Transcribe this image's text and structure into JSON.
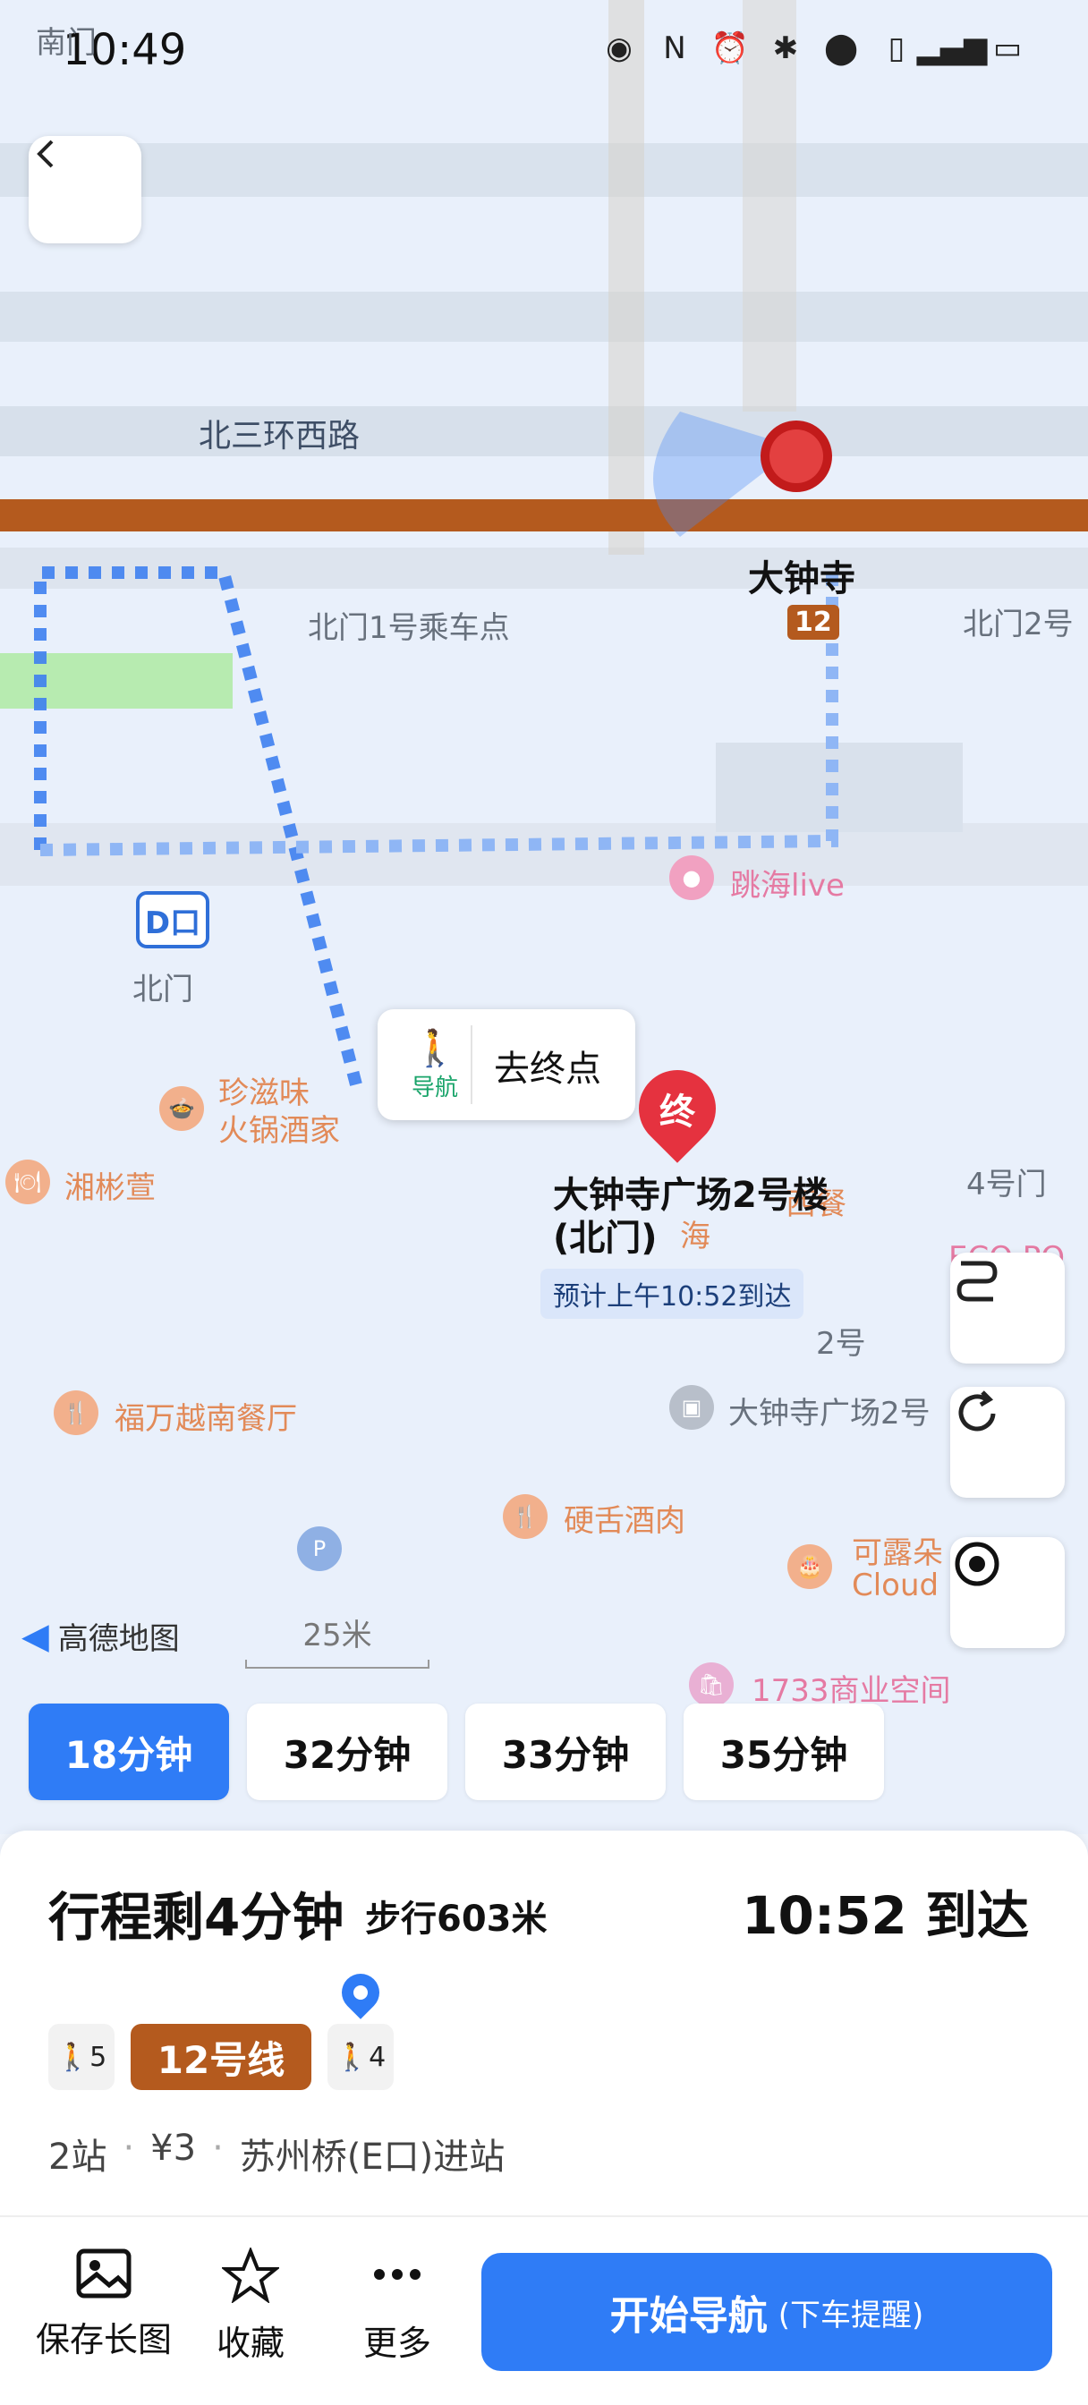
{
  "status": {
    "time": "10:49"
  },
  "map": {
    "labels": {
      "top_left": "南门",
      "road": "北三环西路",
      "station": "大钟寺",
      "line_badge": "12",
      "bus_stop1": "北门1号乘车点",
      "bus_stop2": "北门2号",
      "d_exit": "D口",
      "north_gate": "北门",
      "tiaohai": "跳海live",
      "zhenzi": "珍滋味",
      "hotpot": "火锅酒家",
      "xiangbin": "湘彬萱",
      "gate4": "4号门",
      "xican": "西餐",
      "no2": "2号",
      "fuwan": "福万越南餐厅",
      "plaza2": "大钟寺广场2号",
      "yingshe": "硬舌酒肉",
      "kelu": "可露朵",
      "cloud": "Cloud",
      "space1733": "1733商业空间",
      "partial_sea": "海",
      "partial_d": "d",
      "partial_eco": "ECO PO"
    },
    "nav_popup": {
      "walk_label": "导航",
      "go_label": "去终点"
    },
    "end_marker": "终",
    "destination": "大钟寺广场2号楼(北门)",
    "eta_tag": "预计上午10:52到达",
    "logo_text": "高德地图",
    "scale_text": "25米"
  },
  "tabs": [
    "18分钟",
    "32分钟",
    "33分钟",
    "35分钟"
  ],
  "summary": {
    "trip": "行程剩4分钟",
    "walk": "步行603米",
    "arrive": "10:52 到达",
    "walk_before": "5",
    "line": "12号线",
    "walk_after": "4",
    "stops": "2站",
    "fare": "¥3",
    "enter": "苏州桥(E口)进站"
  },
  "actions": {
    "save": "保存长图",
    "fav": "收藏",
    "more": "更多",
    "start_main": "开始导航",
    "start_sub": "(下车提醒)"
  },
  "colors": {
    "accent": "#2f7cf6",
    "line12": "#b45a1e",
    "end": "#e5323f"
  }
}
